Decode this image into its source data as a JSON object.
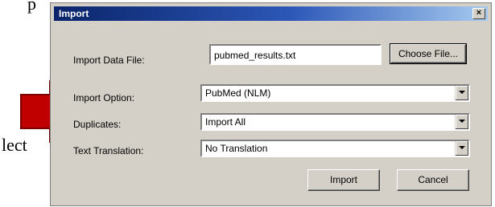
{
  "background_text": {
    "top_fragment": "p",
    "side_fragment": "lect"
  },
  "dialog": {
    "title": "Import",
    "close_label": "×",
    "import_data_file": {
      "label": "Import Data File:",
      "value": "pubmed_results.txt",
      "choose_label": "Choose File..."
    },
    "import_option": {
      "label": "Import Option:",
      "value": "PubMed (NLM)"
    },
    "duplicates": {
      "label": "Duplicates:",
      "value": "Import All"
    },
    "text_translation": {
      "label": "Text Translation:",
      "value": "No Translation"
    },
    "buttons": {
      "import_label": "Import",
      "cancel_label": "Cancel"
    }
  },
  "annotation": {
    "arrow_color": "#c00000",
    "arrow_icon": "arrow-right-icon"
  }
}
